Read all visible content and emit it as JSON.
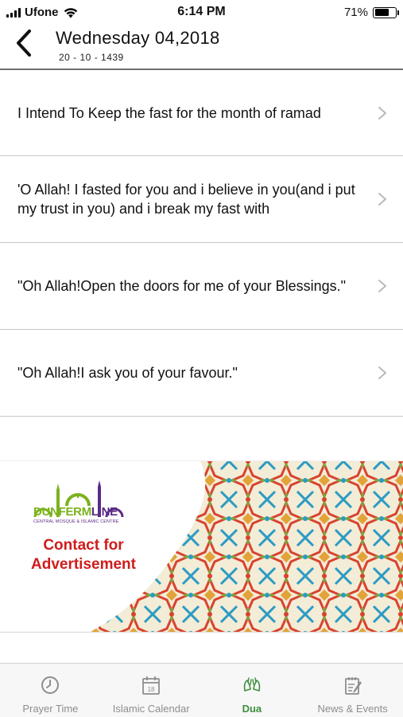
{
  "status_bar": {
    "carrier": "Ufone",
    "time": "6:14 PM",
    "battery": "71%",
    "battery_level": 0.71
  },
  "header": {
    "title": "Wednesday 04,2018",
    "subtitle": "20 - 10 - 1439"
  },
  "duas": [
    {
      "text": "I Intend To Keep the fast for the month of ramad"
    },
    {
      "text": "'O Allah! I fasted for you and i believe in you(and i put my trust in you) and i break my fast with"
    },
    {
      "text": "\"Oh Allah!Open the doors for me of your Blessings.\""
    },
    {
      "text": "\"Oh Allah!I ask you of your favour.\""
    }
  ],
  "ad": {
    "logo_word_green": "DUNFERM",
    "logo_word_purple": "LINE",
    "logo_tagline": "CENTRAL MOSQUE & ISLAMIC CENTRE",
    "cta_line1": "Contact for",
    "cta_line2": "Advertisement"
  },
  "tabs": [
    {
      "label": "Prayer Time",
      "icon": "clock-icon",
      "active": false
    },
    {
      "label": "Islamic Calendar",
      "icon": "calendar-icon",
      "active": false,
      "icon_text": "18"
    },
    {
      "label": "Dua",
      "icon": "praying-hands-icon",
      "active": true
    },
    {
      "label": "News & Events",
      "icon": "notepad-icon",
      "active": false
    }
  ],
  "colors": {
    "accent": "#3d8f3d",
    "ad_red": "#d01c1c",
    "logo_green": "#7cb21e",
    "logo_purple": "#5a2a86"
  }
}
